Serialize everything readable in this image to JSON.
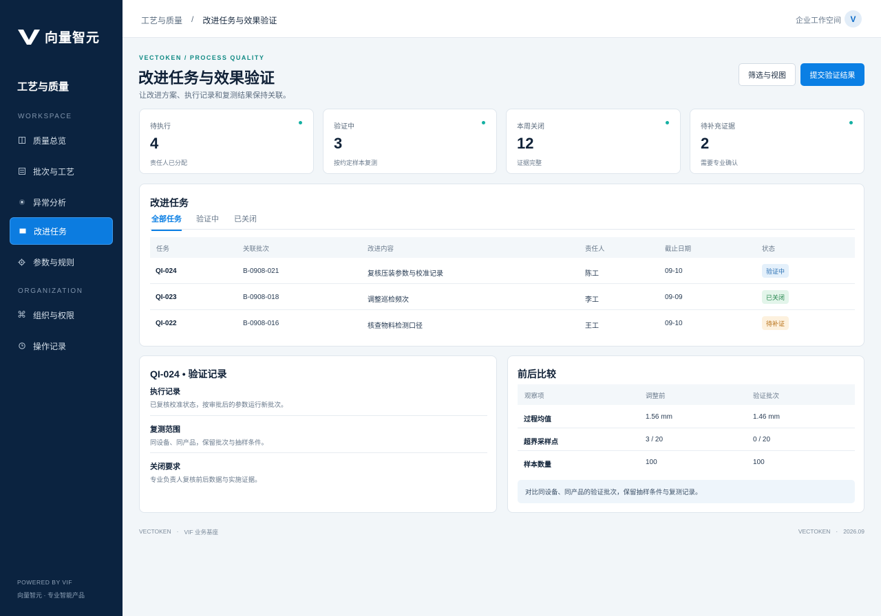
{
  "brand": {
    "name": "向量智元"
  },
  "sidebar": {
    "title": "工艺与质量",
    "section_workspace": "WORKSPACE",
    "section_org": "ORGANIZATION",
    "items": [
      {
        "label": "质量总览",
        "icon": "columns-icon"
      },
      {
        "label": "批次与工艺",
        "icon": "list-icon"
      },
      {
        "label": "异常分析",
        "icon": "dot-icon"
      },
      {
        "label": "改进任务",
        "icon": "square-icon",
        "active": true
      },
      {
        "label": "参数与规则",
        "icon": "gear-icon"
      },
      {
        "label": "组织与权限",
        "icon": "command-icon"
      },
      {
        "label": "操作记录",
        "icon": "clock-icon"
      }
    ],
    "footer_line1": "POWERED BY VIF",
    "footer_line2": "向量智元 · 专业智能产品"
  },
  "topbar": {
    "breadcrumb_parent": "工艺与质量",
    "breadcrumb_sep": "/",
    "breadcrumb_current": "改进任务与效果验证",
    "workspace": "企业工作空间",
    "avatar": "V"
  },
  "header": {
    "eyebrow": "VECTOKEN / PROCESS QUALITY",
    "title": "改进任务与效果验证",
    "subtitle": "让改进方案、执行记录和复测结果保持关联。",
    "filter_button": "筛选与视图",
    "submit_button": "提交验证结果"
  },
  "stats": [
    {
      "label": "待执行",
      "value": "4",
      "note": "责任人已分配"
    },
    {
      "label": "验证中",
      "value": "3",
      "note": "按约定样本复测"
    },
    {
      "label": "本周关闭",
      "value": "12",
      "note": "证据完整"
    },
    {
      "label": "待补充证据",
      "value": "2",
      "note": "需要专业确认"
    }
  ],
  "tasks": {
    "title": "改进任务",
    "tabs": [
      "全部任务",
      "验证中",
      "已关闭"
    ],
    "columns": [
      "任务",
      "关联批次",
      "改进内容",
      "责任人",
      "截止日期",
      "状态"
    ],
    "rows": [
      {
        "id": "QI-024",
        "batch": "B-0908-021",
        "content": "复核压装参数与校准记录",
        "owner": "陈工",
        "due": "09-10",
        "status": "验证中"
      },
      {
        "id": "QI-023",
        "batch": "B-0908-018",
        "content": "调整巡检频次",
        "owner": "李工",
        "due": "09-09",
        "status": "已关闭"
      },
      {
        "id": "QI-022",
        "batch": "B-0908-016",
        "content": "核查物料检测口径",
        "owner": "王工",
        "due": "09-10",
        "status": "待补证"
      }
    ]
  },
  "record": {
    "title": "QI-024 • 验证记录",
    "sections": [
      {
        "heading": "执行记录",
        "text": "已复核校准状态，按审批后的参数运行新批次。"
      },
      {
        "heading": "复测范围",
        "text": "同设备、同产品，保留批次与抽样条件。"
      },
      {
        "heading": "关闭要求",
        "text": "专业负责人复核前后数据与实施证据。"
      }
    ]
  },
  "compare": {
    "title": "前后比较",
    "columns": [
      "观察项",
      "调整前",
      "验证批次"
    ],
    "rows": [
      {
        "item": "过程均值",
        "before": "1.56 mm",
        "after": "1.46 mm"
      },
      {
        "item": "超界采样点",
        "before": "3 / 20",
        "after": "0 / 20"
      },
      {
        "item": "样本数量",
        "before": "100",
        "after": "100"
      }
    ],
    "note": "对比同设备、同产品的验证批次，保留抽样条件与复测记录。"
  },
  "footer": {
    "left1": "VECTOKEN",
    "left_sep": "·",
    "left2": "VIF 业务基座",
    "right1": "VECTOKEN",
    "right_sep": "·",
    "right2": "2026.09"
  }
}
